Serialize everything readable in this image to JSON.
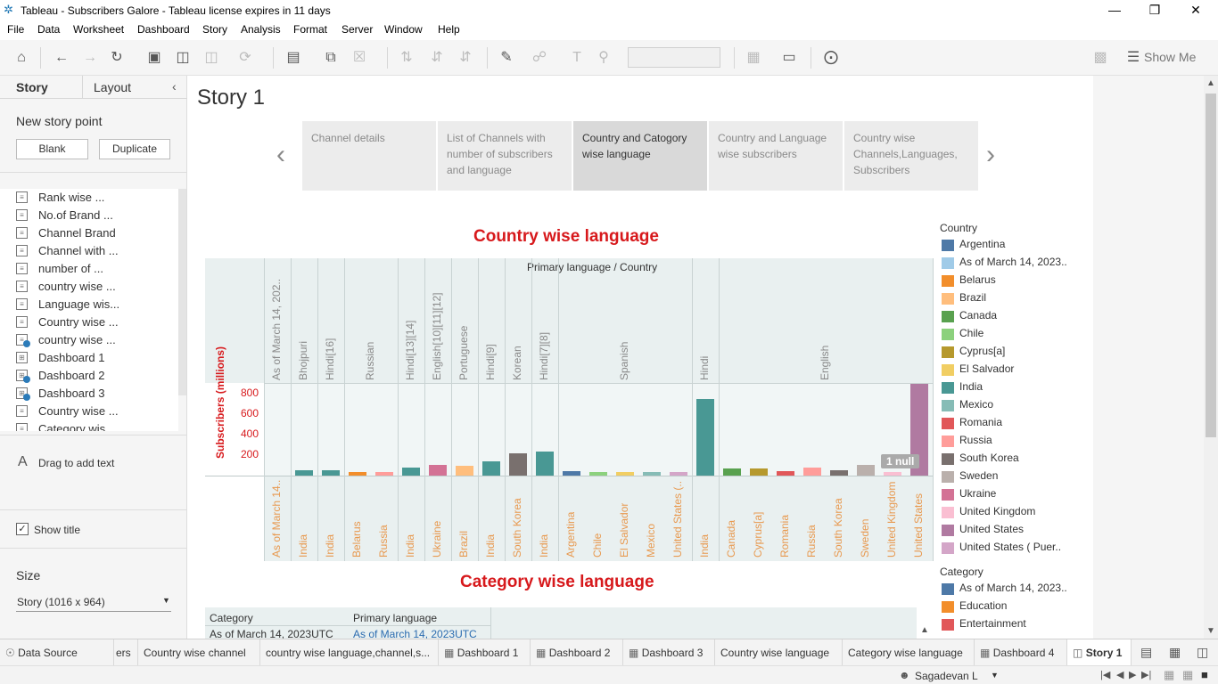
{
  "window": {
    "title": "Tableau - Subscribers Galore - Tableau license expires in 11 days"
  },
  "menu": [
    "File",
    "Data",
    "Worksheet",
    "Dashboard",
    "Story",
    "Analysis",
    "Format",
    "Server",
    "Window",
    "Help"
  ],
  "toolbar": {
    "show_me": "Show Me"
  },
  "left_pane": {
    "tab_story": "Story",
    "tab_layout": "Layout",
    "new_story_point": "New story point",
    "blank_button": "Blank",
    "duplicate_button": "Duplicate",
    "sheets": [
      {
        "label": "Rank wise ...",
        "type": "chart"
      },
      {
        "label": "No.of Brand ...",
        "type": "chart"
      },
      {
        "label": "Channel Brand",
        "type": "chart"
      },
      {
        "label": "Channel with ...",
        "type": "chart"
      },
      {
        "label": "number of ...",
        "type": "chart"
      },
      {
        "label": "country wise ...",
        "type": "chart"
      },
      {
        "label": "Language wis...",
        "type": "chart"
      },
      {
        "label": "Country wise ...",
        "type": "chart"
      },
      {
        "label": "country wise ...",
        "type": "chart-used"
      },
      {
        "label": "Dashboard 1",
        "type": "dashboard"
      },
      {
        "label": "Dashboard 2",
        "type": "dashboard-used"
      },
      {
        "label": "Dashboard 3",
        "type": "dashboard-used"
      },
      {
        "label": "Country wise ...",
        "type": "chart"
      },
      {
        "label": "Category wis...",
        "type": "chart"
      }
    ],
    "drag_text": "Drag to add text",
    "show_title": "Show title",
    "size_label": "Size",
    "size_value": "Story (1016 x 964)"
  },
  "story": {
    "title": "Story 1",
    "points": [
      "Channel details",
      "List of Channels with number of subscribers and language",
      "Country and Catogory wise language",
      "Country and Language wise subscribers",
      "Country wise Channels,Languages, Subscribers"
    ],
    "active_point": 2
  },
  "chart_data": {
    "type": "bar",
    "title": "Country wise language",
    "header": "Primary language  /  Country",
    "ylabel": "Subscribers (millions)",
    "yticks": [
      "200",
      "400",
      "600",
      "800"
    ],
    "ylim": [
      0,
      900
    ],
    "null_label": "1 null",
    "groups": [
      {
        "language": "As of March 14, 202..",
        "bars": [
          {
            "country": "As of March 14..",
            "value": 0
          }
        ]
      },
      {
        "language": "Bhojpuri",
        "bars": [
          {
            "country": "India",
            "value": 50
          }
        ]
      },
      {
        "language": "Hindi[16]",
        "bars": [
          {
            "country": "India",
            "value": 55
          }
        ]
      },
      {
        "language": "Russian",
        "bars": [
          {
            "country": "Belarus",
            "value": 38
          },
          {
            "country": "Russia",
            "value": 38
          }
        ]
      },
      {
        "language": "Hindi[13][14]",
        "bars": [
          {
            "country": "India",
            "value": 80
          }
        ]
      },
      {
        "language": "English[10][11][12]",
        "bars": [
          {
            "country": "Ukraine",
            "value": 100
          }
        ]
      },
      {
        "language": "Portuguese",
        "bars": [
          {
            "country": "Brazil",
            "value": 98
          }
        ]
      },
      {
        "language": "Hindi[9]",
        "bars": [
          {
            "country": "India",
            "value": 138
          }
        ]
      },
      {
        "language": "Korean",
        "bars": [
          {
            "country": "South Korea",
            "value": 215
          }
        ]
      },
      {
        "language": "Hindi[7][8]",
        "bars": [
          {
            "country": "India",
            "value": 230
          }
        ]
      },
      {
        "language": "Spanish",
        "bars": [
          {
            "country": "Argentina",
            "value": 42
          },
          {
            "country": "Chile",
            "value": 36
          },
          {
            "country": "El Salvador",
            "value": 36
          },
          {
            "country": "Mexico",
            "value": 36
          },
          {
            "country": "United States (..",
            "value": 36
          }
        ]
      },
      {
        "language": "Hindi",
        "bars": [
          {
            "country": "India",
            "value": 745
          }
        ]
      },
      {
        "language": "English",
        "bars": [
          {
            "country": "Canada",
            "value": 65
          },
          {
            "country": "Cyprus[a]",
            "value": 72
          },
          {
            "country": "Romania",
            "value": 45
          },
          {
            "country": "Russia",
            "value": 82
          },
          {
            "country": "South Korea",
            "value": 52
          },
          {
            "country": "Sweden",
            "value": 105
          },
          {
            "country": "United Kingdom",
            "value": 38
          },
          {
            "country": "United States",
            "value": 890
          }
        ]
      }
    ]
  },
  "legend": {
    "country_title": "Country",
    "countries": [
      {
        "name": "Argentina",
        "color": "#4e79a7"
      },
      {
        "name": "As of March 14, 2023..",
        "color": "#a0cbe8"
      },
      {
        "name": "Belarus",
        "color": "#f28e2b"
      },
      {
        "name": "Brazil",
        "color": "#ffbe7d"
      },
      {
        "name": "Canada",
        "color": "#59a14f"
      },
      {
        "name": "Chile",
        "color": "#8cd17d"
      },
      {
        "name": "Cyprus[a]",
        "color": "#b6992d"
      },
      {
        "name": "El Salvador",
        "color": "#f1ce63"
      },
      {
        "name": "India",
        "color": "#499894"
      },
      {
        "name": "Mexico",
        "color": "#86bcb6"
      },
      {
        "name": "Romania",
        "color": "#e15759"
      },
      {
        "name": "Russia",
        "color": "#ff9d9a"
      },
      {
        "name": "South Korea",
        "color": "#79706e"
      },
      {
        "name": "Sweden",
        "color": "#bab0ac"
      },
      {
        "name": "Ukraine",
        "color": "#d37295"
      },
      {
        "name": "United Kingdom",
        "color": "#fabfd2"
      },
      {
        "name": "United States",
        "color": "#b07aa1"
      },
      {
        "name": "United States ( Puer..",
        "color": "#d4a6c8"
      }
    ],
    "category_title": "Category",
    "categories": [
      {
        "name": "As of March 14, 2023..",
        "color": "#4e79a7"
      },
      {
        "name": "Education",
        "color": "#f28e2b"
      },
      {
        "name": "Entertainment",
        "color": "#e15759"
      }
    ]
  },
  "second_chart": {
    "title": "Category wise language",
    "col_category": "Category",
    "col_language": "Primary language",
    "row_category": "As of March 14, 2023UTC",
    "row_language": "As of March 14, 2023UTC"
  },
  "bottom_tabs": [
    "Data Source",
    "ers",
    "Country wise channel",
    "country wise language,channel,s...",
    "Dashboard 1",
    "Dashboard 2",
    "Dashboard 3",
    "Country wise language",
    "Category wise language",
    "Dashboard 4",
    "Story 1"
  ],
  "status": {
    "user": "Sagadevan L"
  },
  "colors": {
    "title_red": "#d7191c",
    "axis_orange": "#e8994f"
  }
}
